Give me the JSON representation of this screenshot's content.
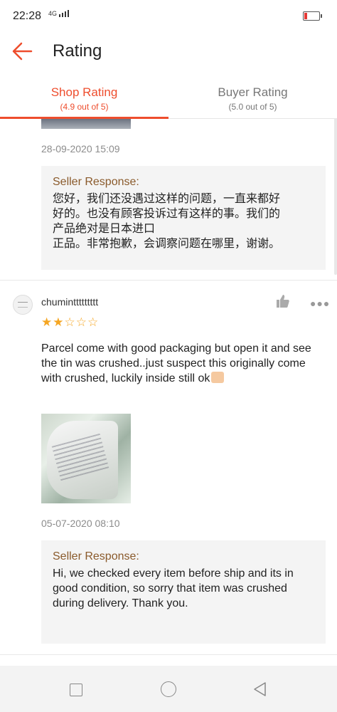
{
  "status_bar": {
    "time": "22:28",
    "network": "4G"
  },
  "header": {
    "title": "Rating"
  },
  "tabs": [
    {
      "label": "Shop Rating",
      "sub": "(4.9 out of 5)"
    },
    {
      "label": "Buyer Rating",
      "sub": "(5.0 out of 5)"
    }
  ],
  "reviews": [
    {
      "date": "28-09-2020 15:09",
      "seller_response_label": "Seller Response:",
      "seller_response_lines": [
        "您好，我们还没遇过这样的问题，一直来都好",
        "好的。也没有顾客投诉过有这样的事。我们的",
        "产品绝对是日本进口",
        "正品。非常抱歉，会调察问题在哪里，谢谢。"
      ]
    },
    {
      "username": "chuminttttttttt",
      "rating": 2,
      "max_rating": 5,
      "text": "Parcel come with good packaging but open it and see the tin was crushed..just suspect this originally come with crushed, luckily inside still ok",
      "date": "05-07-2020 08:10",
      "seller_response_label": "Seller Response:",
      "seller_response": "Hi, we checked every item before ship and its in good condition, so sorry that item was crushed during delivery. Thank you."
    }
  ],
  "colors": {
    "accent": "#ee4d2d",
    "seller_label": "#8a5a2b",
    "star": "#f5a623"
  }
}
